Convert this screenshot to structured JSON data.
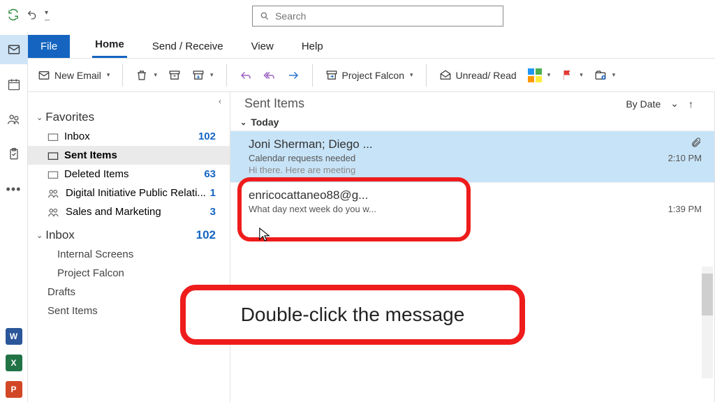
{
  "search": {
    "placeholder": "Search"
  },
  "tabs": {
    "file": "File",
    "home": "Home",
    "sendreceive": "Send / Receive",
    "view": "View",
    "help": "Help"
  },
  "ribbon": {
    "new_email": "New Email",
    "project": "Project Falcon",
    "unread_read": "Unread/ Read"
  },
  "nav": {
    "favorites": "Favorites",
    "inbox": "Inbox",
    "inbox_count": "102",
    "sent_items": "Sent Items",
    "deleted_items": "Deleted Items",
    "deleted_count": "63",
    "digital": "Digital Initiative Public Relati...",
    "digital_count": "1",
    "sales": "Sales and Marketing",
    "sales_count": "3",
    "inbox_header": "Inbox",
    "inbox_header_count": "102",
    "internal_screens": "Internal Screens",
    "project_falcon": "Project Falcon",
    "drafts": "Drafts",
    "sent_items2": "Sent Items"
  },
  "list": {
    "title": "Sent Items",
    "sort_by": "By Date",
    "group_today": "Today",
    "msg1": {
      "from": "Joni Sherman; Diego ...",
      "subject": "Calendar requests needed",
      "time": "2:10 PM",
      "preview": "Hi there. Here are meeting"
    },
    "msg2": {
      "from": "enricocattaneo88@g...",
      "subject": "What day next week do you w...",
      "time": "1:39 PM"
    }
  },
  "callout": "Double-click the message",
  "apps": {
    "word": "W",
    "excel": "X",
    "ppt": "P"
  }
}
